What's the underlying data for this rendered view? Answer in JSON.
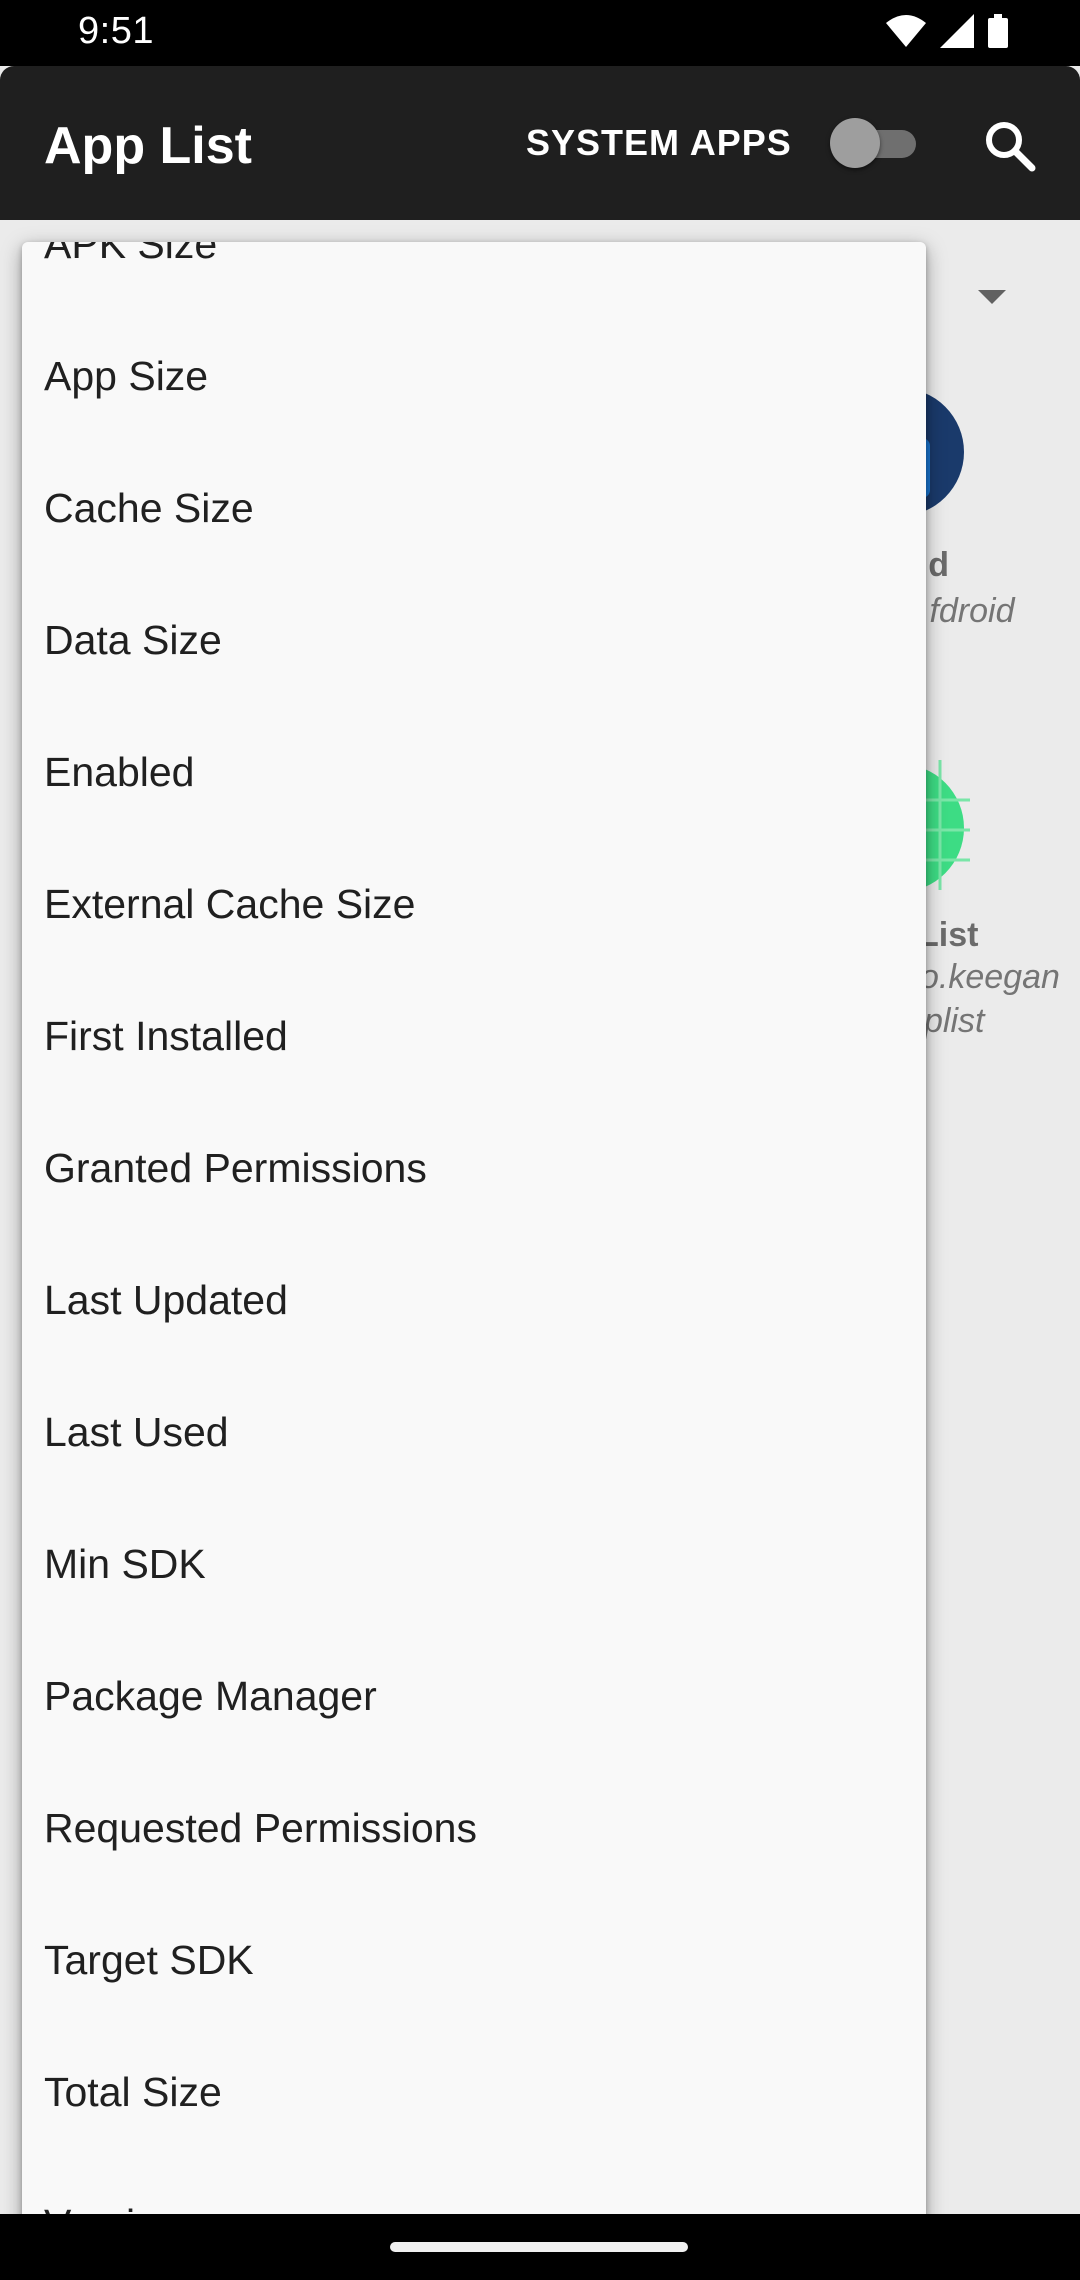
{
  "status_bar": {
    "time": "9:51",
    "icons": [
      "wifi-icon",
      "signal-icon",
      "battery-icon"
    ]
  },
  "toolbar": {
    "title": "App List",
    "system_apps_label": "SYSTEM APPS",
    "system_apps_enabled": false,
    "search_icon": "search-icon"
  },
  "background_list": {
    "items": [
      {
        "name_fragment": "oid",
        "package_fragment": ".fdroid"
      },
      {
        "name_fragment": "List",
        "package_fragment_1": "o.keegan",
        "package_fragment_2": "plist"
      }
    ]
  },
  "sort_menu": {
    "items": [
      "APK Size",
      "App Size",
      "Cache Size",
      "Data Size",
      "Enabled",
      "External Cache Size",
      "First Installed",
      "Granted Permissions",
      "Last Updated",
      "Last Used",
      "Min SDK",
      "Package Manager",
      "Requested Permissions",
      "Target SDK",
      "Total Size",
      "Version"
    ]
  },
  "colors": {
    "toolbar": "#1f1f1f",
    "menu_background": "#f9f9f9",
    "fdroid_blue": "#1565c0",
    "applist_green": "#3ddc84"
  }
}
